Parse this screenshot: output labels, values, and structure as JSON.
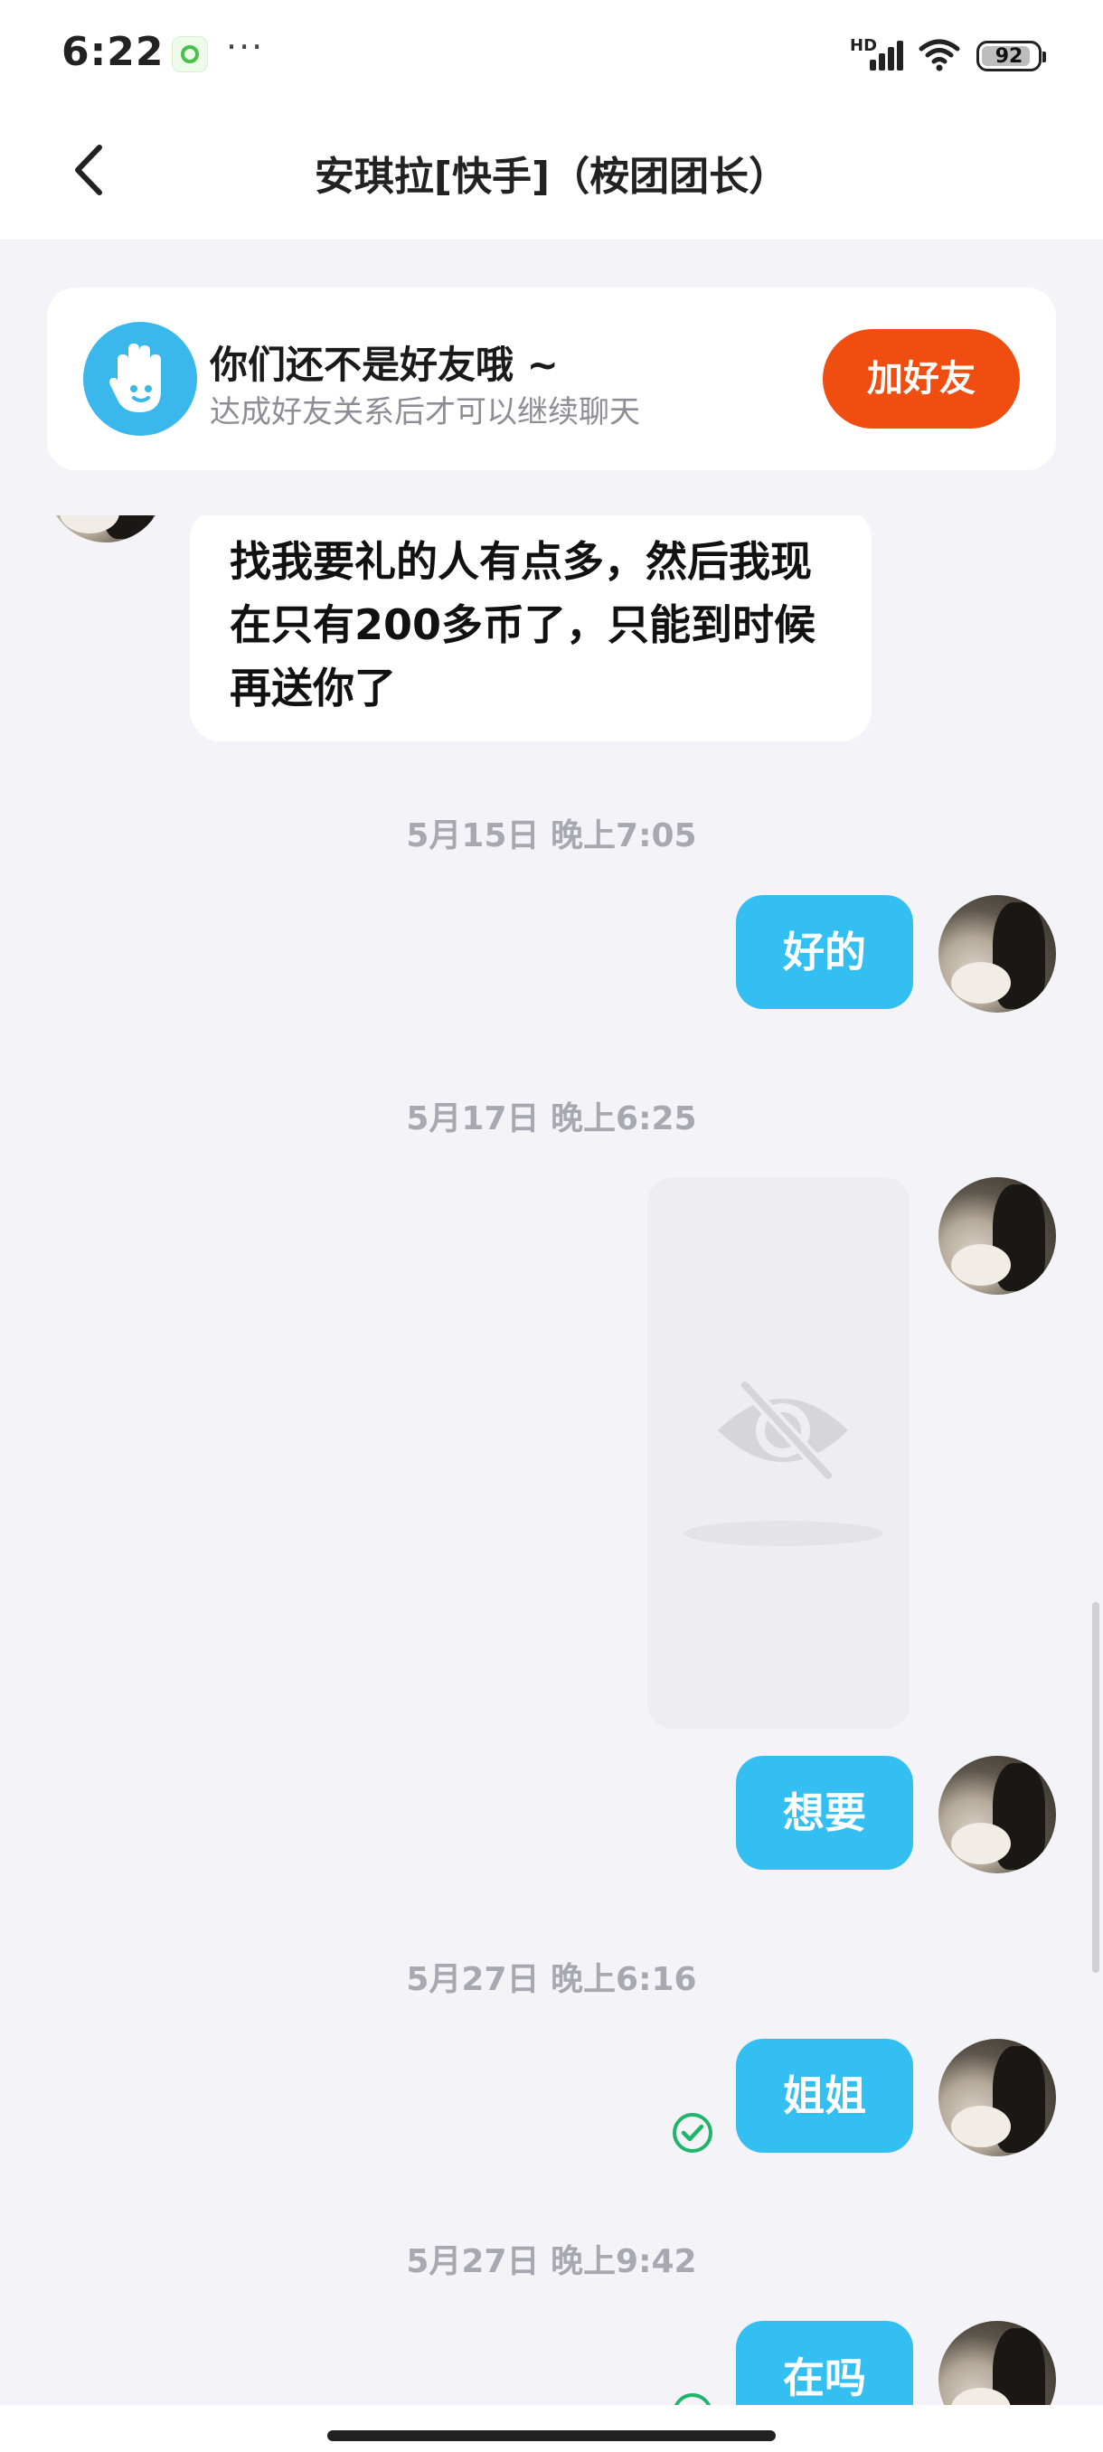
{
  "status_bar": {
    "time": "6:22",
    "more_indicator": "···",
    "network_type": "HD",
    "battery": "92"
  },
  "header": {
    "title": "安琪拉[快手]（桉团团长）"
  },
  "friend_banner": {
    "title": "你们还不是好友哦 ~",
    "subtitle": "达成好友关系后才可以继续聊天",
    "button_label": "加好友",
    "icon": "waving-hand-icon"
  },
  "messages": [
    {
      "type": "received",
      "text": "找我要礼的人有点多，然后我现在只有200多币了，只能到时候再送你了"
    },
    {
      "type": "timestamp",
      "text": "5月15日 晚上7:05"
    },
    {
      "type": "sent",
      "text": "好的"
    },
    {
      "type": "timestamp",
      "text": "5月17日 晚上6:25"
    },
    {
      "type": "image",
      "icon": "hidden-image-icon"
    },
    {
      "type": "sent",
      "text": "想要"
    },
    {
      "type": "timestamp",
      "text": "5月27日 晚上6:16"
    },
    {
      "type": "sent",
      "text": "姐姐",
      "status_icon": "check-circle-icon"
    },
    {
      "type": "timestamp",
      "text": "5月27日 晚上9:42"
    },
    {
      "type": "sent",
      "text": "在吗",
      "status_icon": "check-circle-icon"
    }
  ],
  "colors": {
    "background": "#f3f3f8",
    "accent_blue": "#33bff2",
    "add_friend_orange": "#f04d10",
    "check_green": "#1fb56a"
  }
}
